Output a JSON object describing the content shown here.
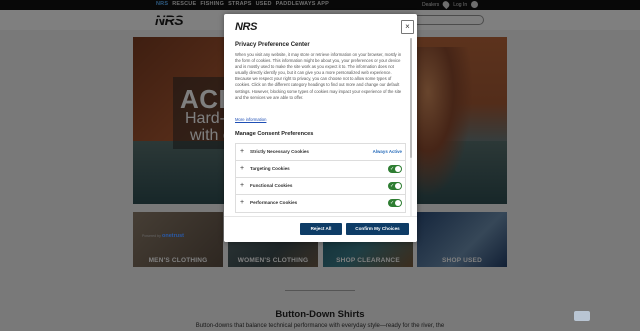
{
  "topnav": {
    "items": [
      "NRS",
      "RESCUE",
      "FISHING",
      "STRAPS",
      "USED",
      "PADDLEWAYS APP"
    ],
    "active_index": 0
  },
  "utility": {
    "dealers": "Dealers",
    "login": "Log In"
  },
  "header": {
    "logo": "NRS"
  },
  "hero": {
    "title": "ACE-H",
    "sub1": "Hard-wo",
    "sub2": "with ca"
  },
  "tiles": [
    {
      "label": "MEN'S CLOTHING"
    },
    {
      "label": "WOMEN'S CLOTHING"
    },
    {
      "label": "SHOP CLEARANCE"
    },
    {
      "label": "SHOP USED"
    }
  ],
  "section": {
    "title": "Button-Down Shirts",
    "text": "Button-downs that balance technical performance with everyday style—ready for the river, the"
  },
  "modal": {
    "logo": "NRS",
    "close_label": "×",
    "title": "Privacy Preference Center",
    "description": "When you visit any website, it may store or retrieve information on your browser, mostly in the form of cookies. This information might be about you, your preferences or your device and is mostly used to make the site work as you expect it to. The information does not usually directly identify you, but it can give you a more personalized web experience. Because we respect your right to privacy, you can choose not to allow some types of cookies. Click on the different category headings to find out more and change our default settings. However, blocking some types of cookies may impact your experience of the site and the services we are able to offer.",
    "more_info": "More information",
    "manage_title": "Manage Consent Preferences",
    "categories": [
      {
        "name": "Strictly Necessary Cookies",
        "status": "Always Active"
      },
      {
        "name": "Targeting Cookies",
        "enabled": true
      },
      {
        "name": "Functional Cookies",
        "enabled": true
      },
      {
        "name": "Performance Cookies",
        "enabled": true
      }
    ],
    "reject_label": "Reject All",
    "confirm_label": "Confirm My Choices",
    "powered_by": "Powered by",
    "powered_brand": "onetrust"
  },
  "colors": {
    "button": "#0e3c66",
    "toggle_on": "#2e7d32",
    "always_active": "#2a6ebb",
    "nav_active": "#5bb3ff"
  }
}
